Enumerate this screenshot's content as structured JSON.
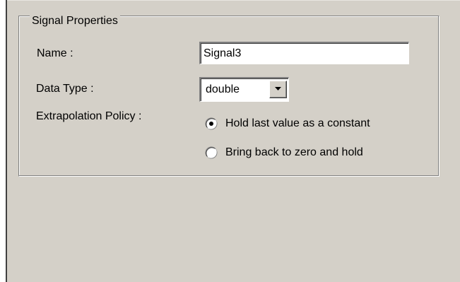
{
  "group": {
    "title": "Signal Properties"
  },
  "fields": {
    "name_label": "Name :",
    "name_value": "Signal3",
    "data_type_label": "Data Type :",
    "data_type_value": "double",
    "extrapolation_label": "Extrapolation Policy :"
  },
  "extrapolation_options": [
    {
      "label": "Hold last value as a constant",
      "selected": true
    },
    {
      "label": "Bring back to zero and hold",
      "selected": false
    }
  ],
  "colors": {
    "dialog_background": "#d4d0c8",
    "field_background": "#ffffff",
    "text": "#000000"
  }
}
